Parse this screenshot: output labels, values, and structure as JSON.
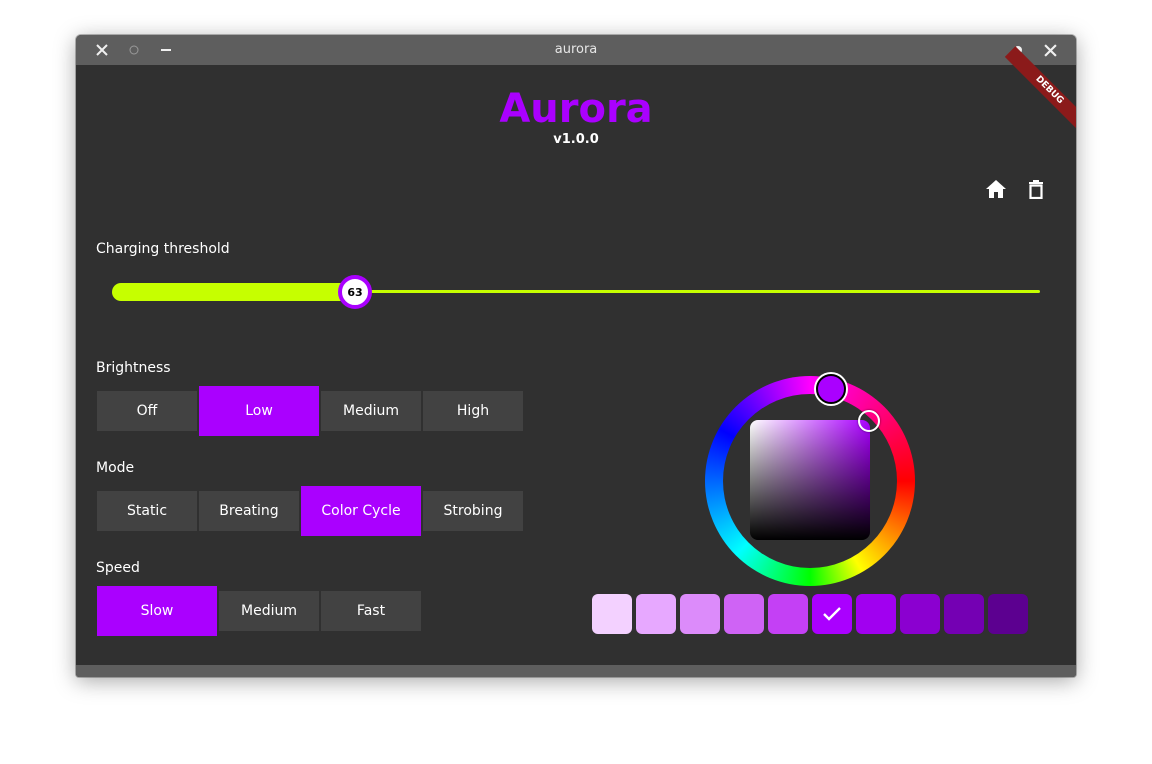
{
  "window": {
    "title": "aurora"
  },
  "header": {
    "app_title": "Aurora",
    "version": "v1.0.0",
    "debug_banner": "DEBUG"
  },
  "charging": {
    "label": "Charging threshold",
    "value": 63,
    "value_text": "63",
    "min": 0,
    "max": 100
  },
  "brightness": {
    "label": "Brightness",
    "options": [
      "Off",
      "Low",
      "Medium",
      "High"
    ],
    "selected": "Low"
  },
  "mode": {
    "label": "Mode",
    "options": [
      "Static",
      "Breating",
      "Color Cycle",
      "Strobing"
    ],
    "selected": "Color Cycle"
  },
  "speed": {
    "label": "Speed",
    "options": [
      "Slow",
      "Medium",
      "Fast"
    ],
    "selected": "Slow"
  },
  "color_picker": {
    "current_color": "#aa00ff",
    "swatches": [
      "#f3d1ff",
      "#e7a8ff",
      "#dc8bfa",
      "#cf63f5",
      "#c440f5",
      "#aa00ff",
      "#a100f0",
      "#8b00d0",
      "#7400b3",
      "#5c0090"
    ],
    "selected_swatch": 5
  },
  "colors": {
    "accent": "#aa00ff",
    "slider": "#c6ff00",
    "background": "#303030",
    "button": "#424242"
  },
  "icons": [
    "close-icon",
    "minimize-icon",
    "maximize-icon",
    "home-icon",
    "delete-icon",
    "check-icon"
  ]
}
